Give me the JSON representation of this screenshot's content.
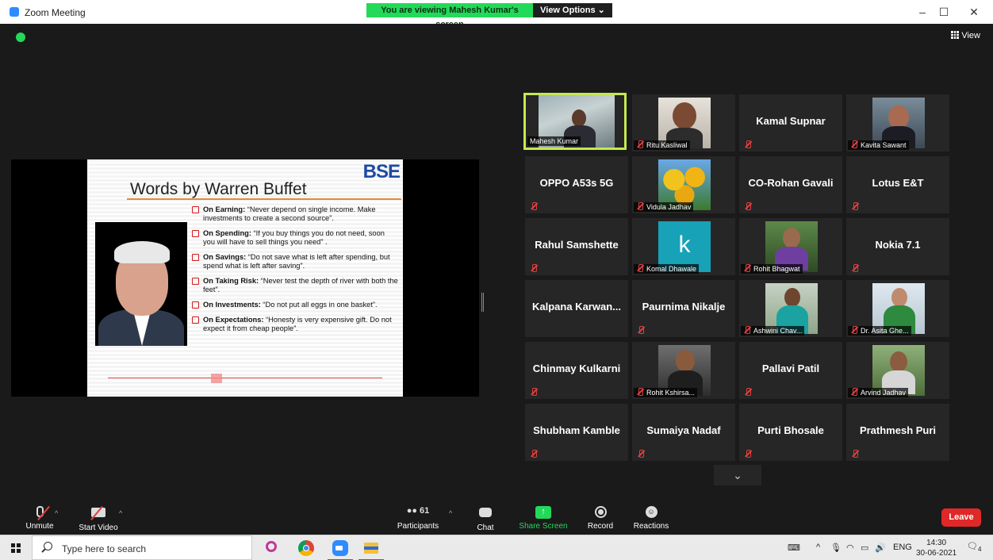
{
  "window": {
    "title": "Zoom Meeting",
    "controls": {
      "minimize": "–",
      "maximize": "☐",
      "close": "✕"
    }
  },
  "banner": {
    "viewing_text": "You are viewing Mahesh Kumar's screen",
    "view_options": "View Options ⌄"
  },
  "meeting": {
    "view_label": "View"
  },
  "slide": {
    "logo": "BSE",
    "title": "Words by Warren Buffet",
    "bullets": [
      {
        "heading": "On Earning:",
        "text": " “Never depend on single income. Make investments to create a second source”."
      },
      {
        "heading": "On Spending:",
        "text": " “If you buy things you do not need, soon you will have to sell things you need” ."
      },
      {
        "heading": "On Savings:",
        "text": " “Do not save what is left after spending, but spend what is left after saving”."
      },
      {
        "heading": "On Taking Risk:",
        "text": " “Never test the depth of river with both the feet”."
      },
      {
        "heading": "On Investments:",
        "text": " “Do not put all eggs in one basket”."
      },
      {
        "heading": "On Expectations:",
        "text": " “Honesty is very expensive gift. Do not expect it from cheap people”."
      }
    ]
  },
  "participants": [
    {
      "name": "Mahesh Kumar",
      "type": "video",
      "muted": false,
      "active": true
    },
    {
      "name": "Ritu Kasliwal",
      "type": "video",
      "muted": true
    },
    {
      "name": "Kamal Supnar",
      "type": "name",
      "muted": true
    },
    {
      "name": "Kavita Sawant",
      "type": "video",
      "muted": true
    },
    {
      "name": "OPPO A53s 5G",
      "type": "name",
      "muted": true
    },
    {
      "name": "Vidula Jadhav",
      "type": "video",
      "muted": true
    },
    {
      "name": "CO-Rohan Gavali",
      "type": "name",
      "muted": true
    },
    {
      "name": "Lotus E&T",
      "type": "name",
      "muted": true
    },
    {
      "name": "Rahul Samshette",
      "type": "name",
      "muted": true
    },
    {
      "name": "Komal Dhawale",
      "type": "video",
      "muted": true
    },
    {
      "name": "Rohit Bhagwat",
      "type": "video",
      "muted": true
    },
    {
      "name": "Nokia 7.1",
      "type": "name",
      "muted": true
    },
    {
      "name": "Kalpana Karwan...",
      "type": "name",
      "muted": false
    },
    {
      "name": "Paurnima Nikalje",
      "type": "name",
      "muted": true
    },
    {
      "name": "Ashwini Chav...",
      "type": "video",
      "muted": true
    },
    {
      "name": "Dr. Asita Ghe...",
      "type": "video",
      "muted": true
    },
    {
      "name": "Chinmay Kulkarni",
      "type": "name",
      "muted": true
    },
    {
      "name": "Rohit Kshirsa...",
      "type": "video",
      "muted": true
    },
    {
      "name": "Pallavi Patil",
      "type": "name",
      "muted": true
    },
    {
      "name": "Arvind Jadhav",
      "type": "video",
      "muted": true
    },
    {
      "name": "Shubham Kamble",
      "type": "name",
      "muted": true
    },
    {
      "name": "Sumaiya Nadaf",
      "type": "name",
      "muted": true
    },
    {
      "name": "Purti Bhosale",
      "type": "name",
      "muted": true
    },
    {
      "name": "Prathmesh Puri",
      "type": "name",
      "muted": true
    }
  ],
  "komal_avatar_letter": "k",
  "more_arrow": "⌄",
  "toolbar": {
    "unmute": "Unmute",
    "start_video": "Start Video",
    "participants": "Participants",
    "participants_count": "61",
    "chat": "Chat",
    "share_screen": "Share Screen",
    "record": "Record",
    "reactions": "Reactions",
    "leave": "Leave"
  },
  "taskbar": {
    "search_placeholder": "Type here to search",
    "language": "ENG",
    "time": "14:30",
    "date": "30-06-2021",
    "notification_count": "4"
  },
  "colors": {
    "zoom_blue": "#2d8cff",
    "share_green": "#23d959",
    "leave_red": "#e02828",
    "active_speaker": "#c4e94e"
  }
}
